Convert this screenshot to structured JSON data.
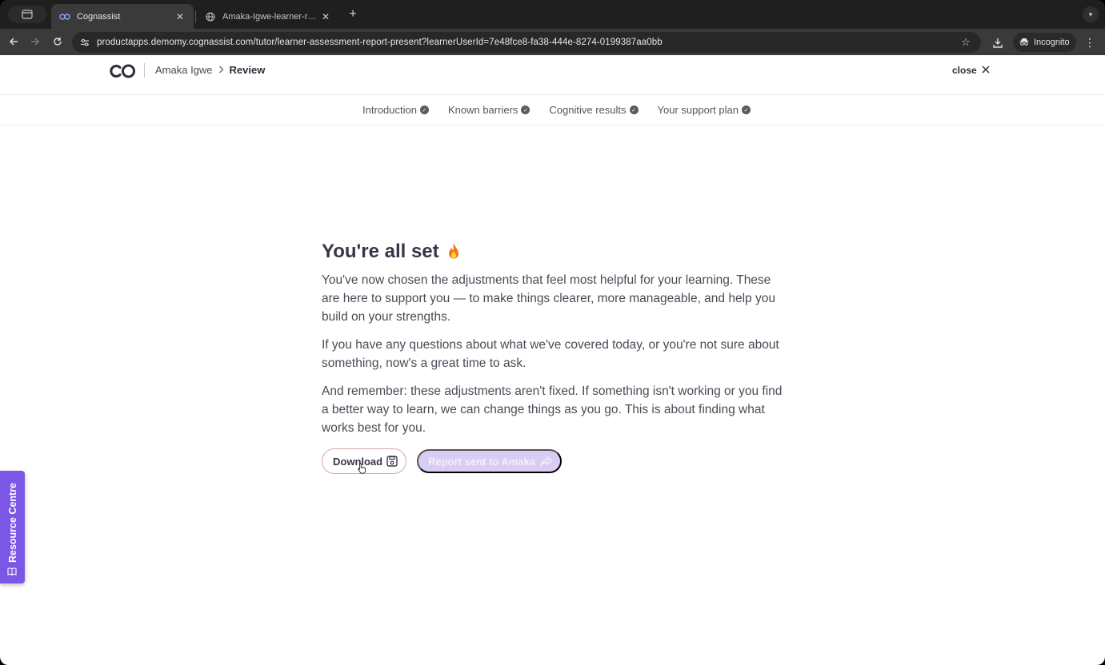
{
  "browser": {
    "tabs": [
      {
        "title": "Cognassist",
        "active": true
      },
      {
        "title": "Amaka-Igwe-learner-report.pdf",
        "active": false
      }
    ],
    "url": "productapps.demomy.cognassist.com/tutor/learner-assessment-report-present?learnerUserId=7e48fce8-fa38-444e-8274-0199387aa0bb",
    "incognito_label": "Incognito"
  },
  "header": {
    "breadcrumb_learner": "Amaka Igwe",
    "breadcrumb_current": "Review",
    "close_label": "close"
  },
  "steps": [
    {
      "label": "Introduction"
    },
    {
      "label": "Known barriers"
    },
    {
      "label": "Cognitive results"
    },
    {
      "label": "Your support plan"
    }
  ],
  "main": {
    "heading": "You're all set",
    "paragraphs": [
      "You've now chosen the adjustments that feel most helpful for your learning. These are here to support you — to make things clearer, more manageable, and help you build on your strengths.",
      "If you have any questions about what we've covered today, or you're not sure about something, now's a great time to ask.",
      "And remember: these adjustments aren't fixed. If something isn't working or you find a better way to learn, we can change things as you go. This is about finding what works best for you."
    ],
    "download_label": "Download",
    "report_label": "Report sent to Amaka"
  },
  "resource_centre": {
    "label": "Resource Centre"
  },
  "colors": {
    "accent": "#7b57e6",
    "report_button": "#d9cdf4",
    "download_border": "#d9a4b4",
    "heading_text": "#36364a"
  },
  "icons": {
    "heading_emoji": "fire-icon",
    "download": "save-icon",
    "report": "share-icon"
  }
}
